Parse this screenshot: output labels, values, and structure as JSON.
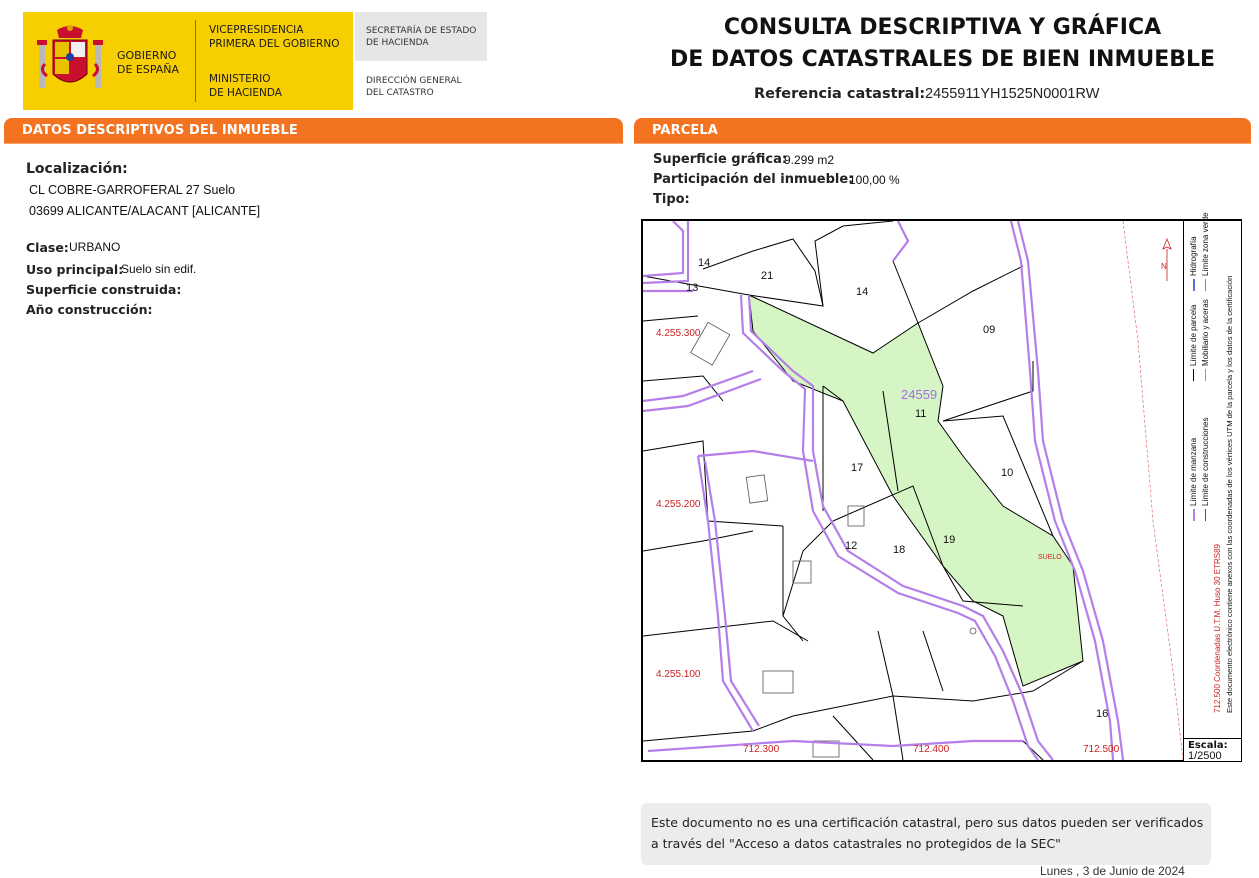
{
  "header": {
    "gov_line1": "GOBIERNO",
    "gov_line2": "DE ESPAÑA",
    "vice_line1": "VICEPRESIDENCIA",
    "vice_line2": "PRIMERA DEL GOBIERNO",
    "min_line1": "MINISTERIO",
    "min_line2": "DE HACIENDA",
    "sec_line1": "SECRETARÍA DE ESTADO",
    "sec_line2": "DE HACIENDA",
    "dg_line1": "DIRECCIÓN GENERAL",
    "dg_line2": "DEL CATASTRO",
    "title_line1": "CONSULTA DESCRIPTIVA Y GRÁFICA",
    "title_line2": "DE DATOS CATASTRALES DE BIEN INMUEBLE",
    "ref_label": "Referencia catastral:",
    "ref_value": "2455911YH1525N0001RW"
  },
  "left": {
    "section_title": "DATOS DESCRIPTIVOS DEL INMUEBLE",
    "loc_label": "Localización:",
    "loc_line1": "CL COBRE-GARROFERAL 27 Suelo",
    "loc_line2": "03699 ALICANTE/ALACANT [ALICANTE]",
    "clase_label": "Clase:",
    "clase_value": "URBANO",
    "uso_label": "Uso principal:",
    "uso_value": "Suelo sin edif.",
    "sup_label": "Superficie construida:",
    "anio_label": "Año construcción:"
  },
  "right": {
    "section_title": "PARCELA",
    "sup_label": "Superficie gráfica:",
    "sup_value": "9.299 m2",
    "part_label": "Participación del inmueble:",
    "part_value": "100,00 %",
    "tipo_label": "Tipo:"
  },
  "map": {
    "parcel_labels": [
      "14",
      "21",
      "13",
      "14",
      "09",
      "11",
      "17",
      "10",
      "12",
      "18",
      "19",
      "16"
    ],
    "parcel_ref": "24559",
    "suelo_label": "SUELO",
    "y_coords": [
      "4.255.300",
      "4.255.200",
      "4.255.100"
    ],
    "x_coords": [
      "712.300",
      "712.400",
      "712.500"
    ],
    "legend": {
      "manzana": "Límite de manzana",
      "parcela": "Límite de parcela",
      "hidrografia": "Hidrografía",
      "construcciones": "Límite de construcciones",
      "mobiliario": "Mobiliario y aceras",
      "zona_verde": "Límite zona verde",
      "coords": "712.500 Coordenadas U.T.M. Huso 30 ETRS89",
      "doc_note": "Este documento electrónico contiene anexos con las coordenadas de los vértices UTM de la parcela y los datos de la certificación"
    },
    "scale_label": "Escala:",
    "scale_value": "1/2500",
    "colors": {
      "parcel_fill": "#d6f5c4",
      "boundary": "#b57ee8",
      "coord_text": "#cc2222"
    }
  },
  "footer": {
    "note": "Este documento no es una certificación catastral, pero sus datos pueden ser verificados a través del \"Acceso a datos catastrales no protegidos de la SEC\"",
    "date": "Lunes , 3 de Junio de 2024"
  }
}
